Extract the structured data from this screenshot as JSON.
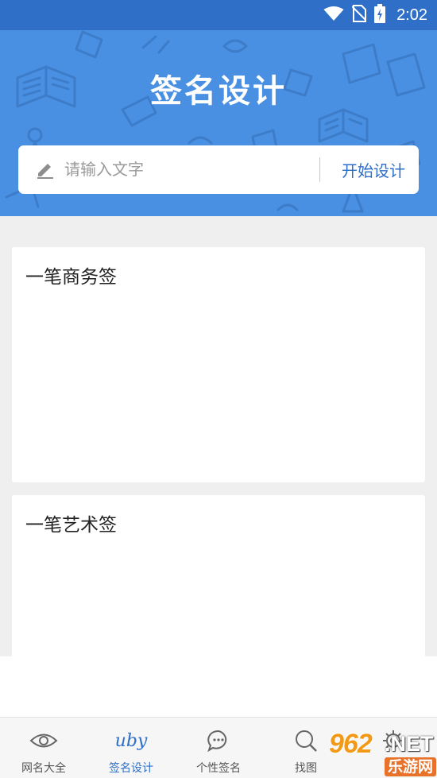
{
  "status_bar": {
    "time": "2:02",
    "icons": [
      "wifi-icon",
      "no-sim-icon",
      "battery-charging-icon"
    ]
  },
  "header": {
    "title": "签名设计",
    "background_color": "#4a90e2"
  },
  "search": {
    "placeholder": "请输入文字",
    "value": "",
    "button_label": "开始设计",
    "icon": "pencil-icon"
  },
  "cards": [
    {
      "title": "一笔商务签"
    },
    {
      "title": "一笔艺术签"
    }
  ],
  "tabbar": {
    "items": [
      {
        "label": "网名大全",
        "icon": "eye-icon",
        "active": false
      },
      {
        "label": "签名设计",
        "icon": "signature-icon",
        "icon_text": "uby",
        "active": true
      },
      {
        "label": "个性签名",
        "icon": "chat-bubble-icon",
        "active": false
      },
      {
        "label": "找图",
        "icon": "search-icon",
        "active": false
      },
      {
        "label": "",
        "icon": "gear-icon",
        "active": false
      }
    ]
  },
  "watermark": {
    "digits": "962",
    "suffix": ".NET",
    "badge": "乐游网"
  },
  "colors": {
    "status_bar": "#2f6fc8",
    "accent": "#2f6fc8",
    "content_background": "#efefef"
  }
}
